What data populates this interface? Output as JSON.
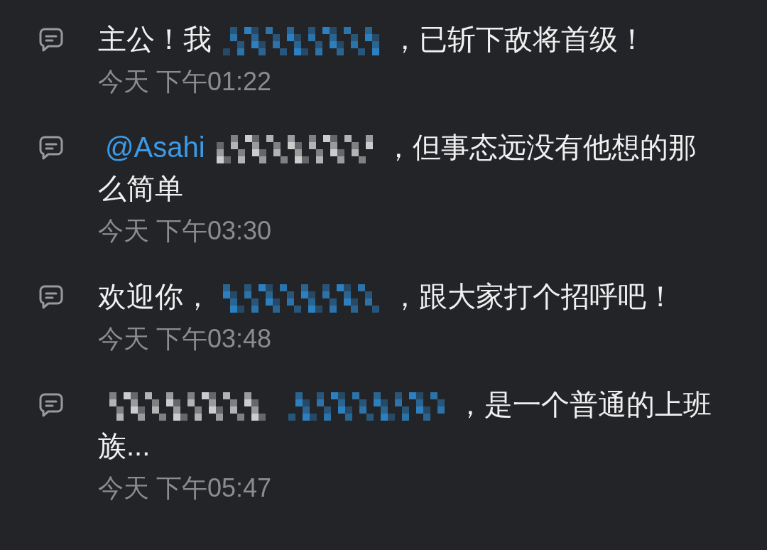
{
  "messages": [
    {
      "parts": [
        {
          "kind": "text",
          "text": "主公！我"
        },
        {
          "kind": "redacted_mention"
        },
        {
          "kind": "text",
          "text": "，已斩下敌将首级！"
        }
      ],
      "time": "今天 下午01:22"
    },
    {
      "parts": [
        {
          "kind": "mention",
          "text": "@Asahi"
        },
        {
          "kind": "redacted"
        },
        {
          "kind": "text",
          "text": "，但事态远没有他想的那么简单"
        }
      ],
      "time": "今天 下午03:30"
    },
    {
      "parts": [
        {
          "kind": "text",
          "text": "欢迎你，"
        },
        {
          "kind": "redacted_mention"
        },
        {
          "kind": "text",
          "text": "，跟大家打个招呼吧！"
        }
      ],
      "time": "今天 下午03:48"
    },
    {
      "parts": [
        {
          "kind": "redacted"
        },
        {
          "kind": "redacted_mention"
        },
        {
          "kind": "text",
          "text": "，是一个普通的上班族..."
        }
      ],
      "time": "今天 下午05:47"
    }
  ]
}
